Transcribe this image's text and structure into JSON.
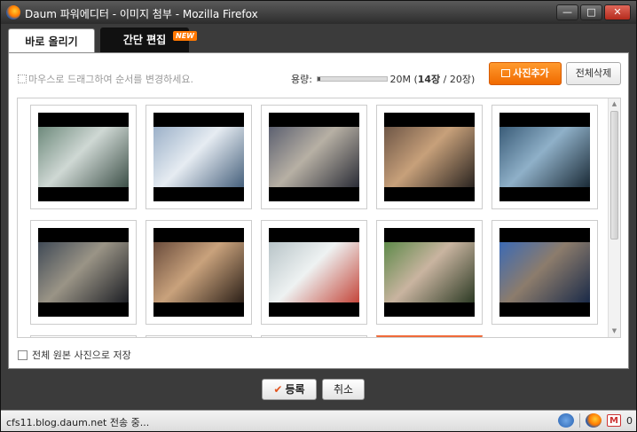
{
  "window": {
    "title": "Daum 파워에디터 - 이미지 첨부 - Mozilla Firefox",
    "minimize": "—",
    "maximize": "□",
    "close": "✕"
  },
  "tabs": {
    "active": "바로 올리기",
    "inactive": "간단 편집",
    "badge": "NEW"
  },
  "toolbar": {
    "hint": "마우스로 드래그하여 순서를 변경하세요.",
    "capacity_label": "용량:",
    "capacity_value": "20M",
    "capacity_fill_fraction": 0.03,
    "count_current": "14장",
    "count_sep": " / ",
    "count_total": "20장",
    "add_photo": "사진추가",
    "delete_all": "전체삭제"
  },
  "thumbnails": [
    {
      "palette": [
        "#6e8a7c",
        "#cfd8d4",
        "#3d5048"
      ]
    },
    {
      "palette": [
        "#9bb0c8",
        "#e6ecf2",
        "#46607c"
      ]
    },
    {
      "palette": [
        "#5c6070",
        "#b7b0a4",
        "#2a2c36"
      ]
    },
    {
      "palette": [
        "#6e5646",
        "#c7a07a",
        "#2a2420"
      ]
    },
    {
      "palette": [
        "#3a5c78",
        "#8fb0c8",
        "#1a2a36"
      ]
    },
    {
      "palette": [
        "#404a56",
        "#9a9486",
        "#1c1e24"
      ]
    },
    {
      "palette": [
        "#6a4c3c",
        "#c9a27c",
        "#2c2018"
      ]
    },
    {
      "palette": [
        "#b8c4c8",
        "#eef2f2",
        "#c4463a"
      ]
    },
    {
      "palette": [
        "#5e8a4a",
        "#c9b4a0",
        "#2c3a24"
      ]
    },
    {
      "palette": [
        "#3c6ab4",
        "#8c7c6c",
        "#1a2a48"
      ]
    }
  ],
  "footer": {
    "save_original": "전체 원본 사진으로 저장",
    "register": "등록",
    "cancel": "취소"
  },
  "status": {
    "text": "cfs11.blog.daum.net 전송 중...",
    "mail_count": "0"
  }
}
